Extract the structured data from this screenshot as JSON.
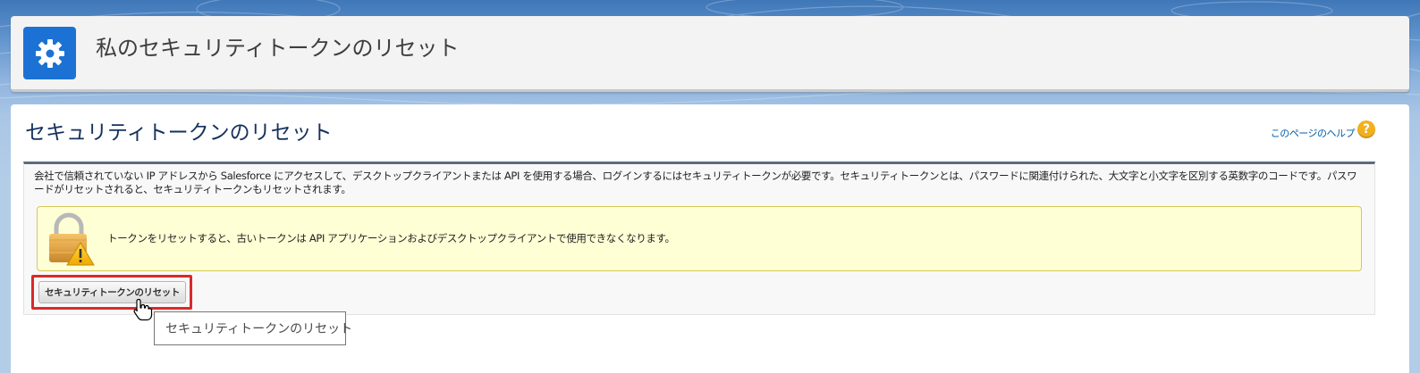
{
  "header": {
    "title": "私のセキュリティトークンのリセット",
    "icon": "gear-icon",
    "icon_color": "#1b72d4"
  },
  "main": {
    "section_title": "セキュリティトークンのリセット",
    "help_link": "このページのヘルプ",
    "help_icon": "question-icon",
    "description": "会社で信頼されていない IP アドレスから Salesforce にアクセスして、デスクトップクライアントまたは API を使用する場合、ログインするにはセキュリティトークンが必要です。セキュリティトークンとは、パスワードに関連付けられた、大文字と小文字を区別する英数字のコードです。パスワードがリセットされると、セキュリティトークンもリセットされます。",
    "warning": {
      "icon": "lock-warning-icon",
      "text": "トークンをリセットすると、古いトークンは API アプリケーションおよびデスクトップクライアントで使用できなくなります。"
    },
    "reset_button_label": "セキュリティトークンのリセット",
    "tooltip": "セキュリティトークンのリセット"
  },
  "colors": {
    "accent": "#1b72d4",
    "highlight": "#d92a2a",
    "warning_bg": "#ffffd5",
    "link": "#015ba7"
  }
}
